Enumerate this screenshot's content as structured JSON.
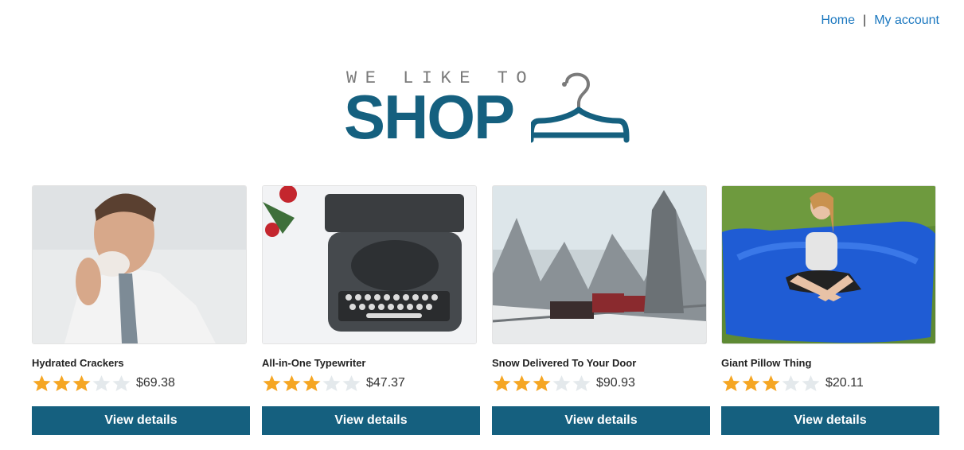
{
  "nav": {
    "home": "Home",
    "separator": "|",
    "account": "My account"
  },
  "logo": {
    "tagline": "WE LIKE TO",
    "wordmark": "SHOP"
  },
  "products": [
    {
      "title": "Hydrated Crackers",
      "rating": 3,
      "max_rating": 5,
      "price": "$69.38",
      "button": "View details"
    },
    {
      "title": "All-in-One Typewriter",
      "rating": 3,
      "max_rating": 5,
      "price": "$47.37",
      "button": "View details"
    },
    {
      "title": "Snow Delivered To Your Door",
      "rating": 3,
      "max_rating": 5,
      "price": "$90.93",
      "button": "View details"
    },
    {
      "title": "Giant Pillow Thing",
      "rating": 3,
      "max_rating": 5,
      "price": "$20.11",
      "button": "View details"
    }
  ],
  "colors": {
    "link": "#1a77bf",
    "brand": "#15607f",
    "star_on": "#f5a623",
    "star_off": "#e4e9ec"
  }
}
